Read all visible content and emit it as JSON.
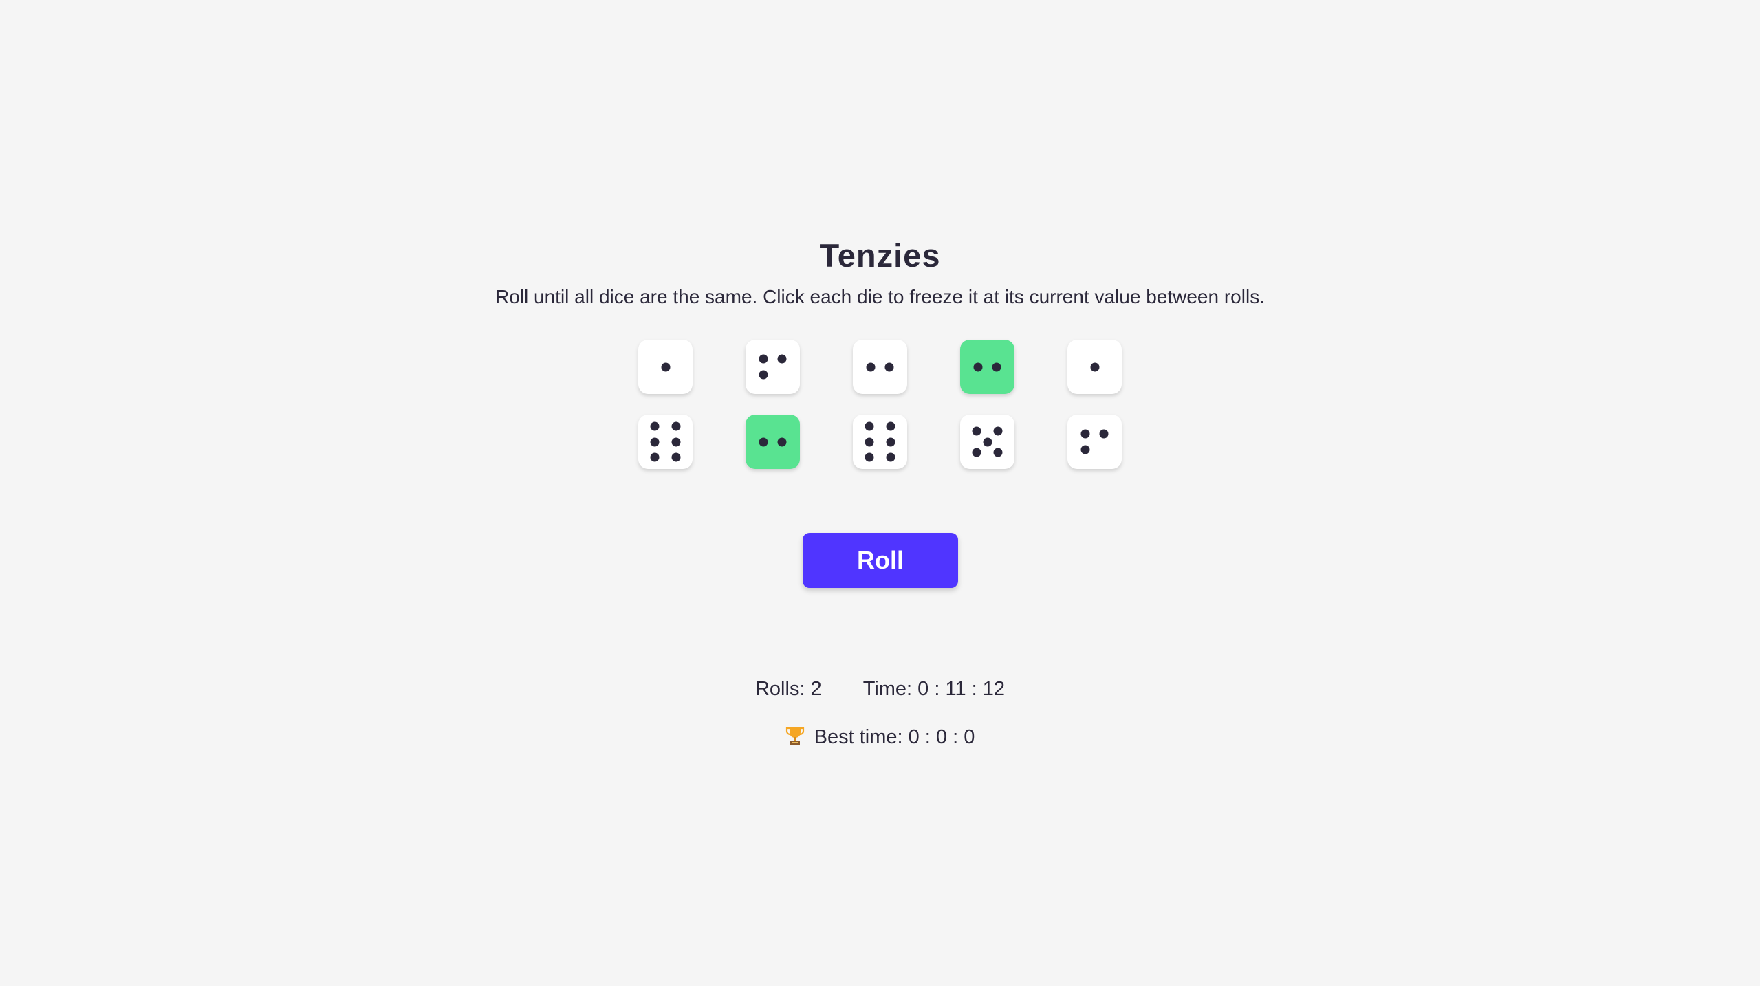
{
  "game": {
    "title": "Tenzies",
    "instructions": "Roll until all dice are the same. Click each die to freeze it at its current value between rolls."
  },
  "dice": [
    {
      "value": 1,
      "held": false
    },
    {
      "value": 3,
      "held": false
    },
    {
      "value": 2,
      "held": false
    },
    {
      "value": 2,
      "held": true
    },
    {
      "value": 1,
      "held": false
    },
    {
      "value": 6,
      "held": false
    },
    {
      "value": 2,
      "held": true
    },
    {
      "value": 6,
      "held": false
    },
    {
      "value": 5,
      "held": false
    },
    {
      "value": 3,
      "held": false
    }
  ],
  "controls": {
    "roll_label": "Roll"
  },
  "stats": {
    "rolls_text": "Rolls: 2",
    "time_text": "Time: 0 : 11 : 12",
    "best_time_text": "Best time: 0 : 0 : 0"
  },
  "icons": {
    "trophy": "trophy-icon"
  },
  "colors": {
    "background": "#f5f5f5",
    "die_face": "#ffffff",
    "die_held": "#59e391",
    "pip": "#2b283a",
    "button": "#5035ff",
    "text": "#2b283a"
  }
}
